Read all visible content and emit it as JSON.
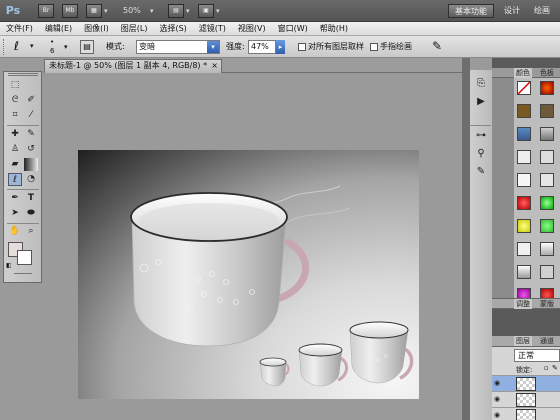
{
  "appbar": {
    "logo": "Ps",
    "bridge_icon": "Br",
    "minibridge_icon": "Mb",
    "zoom": "50%",
    "workspaces": [
      "基本功能",
      "设计",
      "绘画"
    ],
    "icons": [
      "view-extras-icon",
      "zoom-dropdown",
      "arrange-documents-icon",
      "screen-mode-icon"
    ]
  },
  "menubar": {
    "items": [
      "文件(F)",
      "编辑(E)",
      "图像(I)",
      "图层(L)",
      "选择(S)",
      "滤镜(T)",
      "视图(V)",
      "窗口(W)",
      "帮助(H)"
    ]
  },
  "options": {
    "brush_size": "6",
    "mode_label": "模式:",
    "mode_value": "变暗",
    "strength_label": "强度:",
    "strength_value": "47%",
    "sample_all_layers": "对所有图层取样",
    "finger_painting": "手指绘画"
  },
  "document": {
    "tab_title": "未标题-1 @ 50% (图层 1 副本 4, RGB/8) *",
    "close": "×"
  },
  "toolbox": {
    "tools": [
      "marquee-tool-icon",
      "lasso-tool-icon",
      "quick-select-tool-icon",
      "crop-tool-icon",
      "eyedropper-tool-icon",
      "spot-healing-tool-icon",
      "brush-tool-icon",
      "clone-stamp-tool-icon",
      "history-brush-tool-icon",
      "eraser-tool-icon",
      "gradient-tool-icon",
      "smudge-tool-icon",
      "dodge-tool-icon",
      "pen-tool-icon",
      "type-tool-icon",
      "path-select-tool-icon",
      "shape-tool-icon",
      "hand-tool-icon",
      "zoom-tool-icon"
    ],
    "fg_color": "#e6dcdc",
    "bg_color": "#ffffff"
  },
  "panels": {
    "swatch_tabs": [
      "颜色",
      "色板"
    ],
    "adjust_tabs": [
      "调整",
      "蒙版"
    ],
    "layer_tabs": [
      "图层",
      "通道"
    ],
    "blend_mode": "正常",
    "lock_label": "锁定:"
  },
  "colors": {
    "accent": "#2f5fae",
    "cup_handle": "#b88a9a"
  }
}
